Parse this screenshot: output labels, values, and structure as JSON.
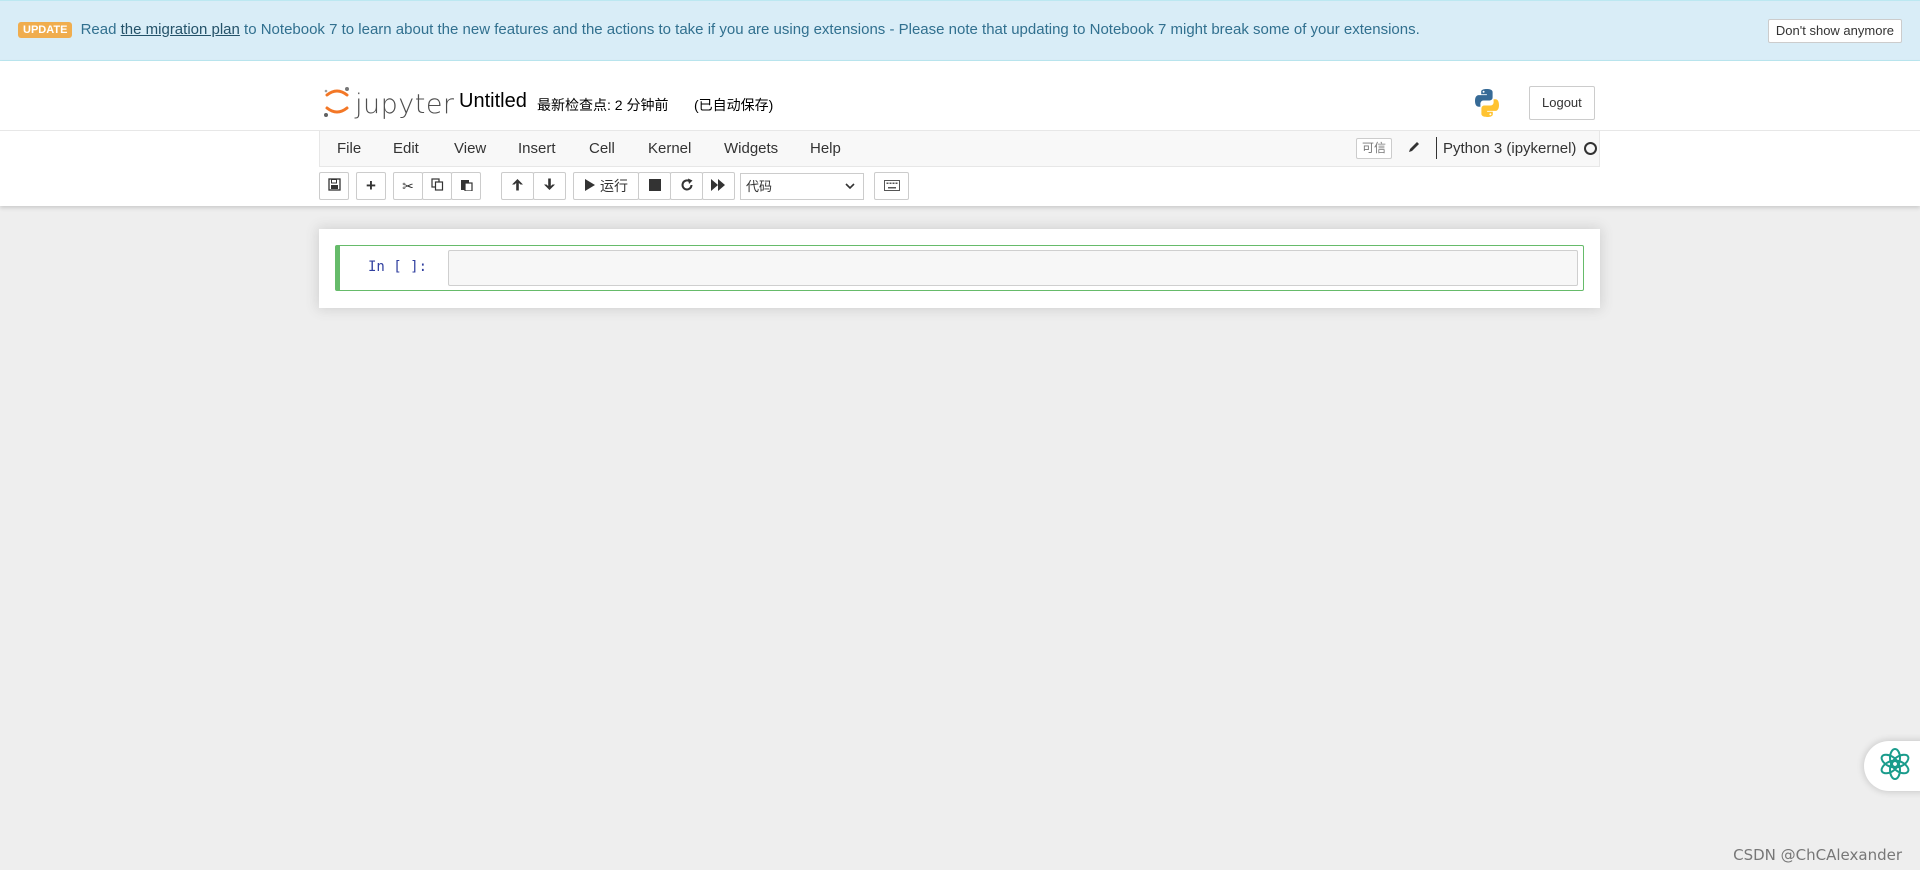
{
  "banner": {
    "badge": "UPDATE",
    "text_before": "Read",
    "link": "the migration plan",
    "text_after": "to Notebook 7 to learn about the new features and the actions to take if you are using extensions - Please note that updating to Notebook 7 might break some of your extensions.",
    "dismiss": "Don't show anymore"
  },
  "header": {
    "logo_text": "jupyter",
    "notebook_title": "Untitled",
    "checkpoint": "最新检查点: 2 分钟前",
    "autosave": "(已自动保存)",
    "logout": "Logout"
  },
  "menu": {
    "items": [
      "File",
      "Edit",
      "View",
      "Insert",
      "Cell",
      "Kernel",
      "Widgets",
      "Help"
    ],
    "trusted": "可信",
    "kernel_name": "Python 3 (ipykernel)"
  },
  "toolbar": {
    "run_label": "运行",
    "cell_type": "代码"
  },
  "cell": {
    "prompt": "In [ ]:",
    "source": ""
  },
  "watermark": "CSDN @ChCAlexander",
  "colors": {
    "banner_bg": "#d9edf7",
    "badge": "#f0ad4e",
    "cell_border": "#66bb6a",
    "jupyter_orange": "#f37726"
  },
  "icons": {
    "logo": "jupyter-logo-icon",
    "python": "python-logo-icon",
    "pencil": "pencil-icon",
    "kernel_status": "kernel-idle-circle-icon",
    "assistant": "assistant-flower-icon"
  }
}
